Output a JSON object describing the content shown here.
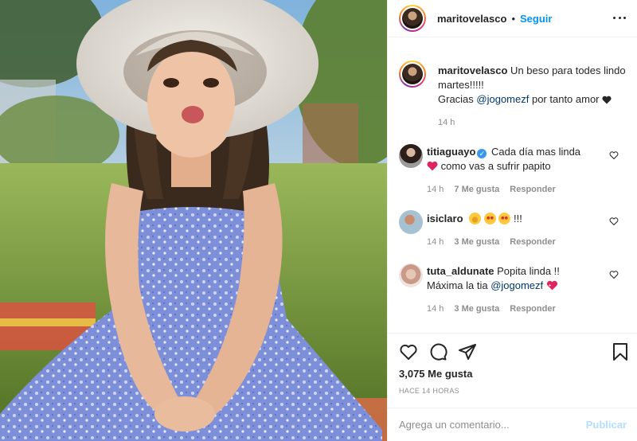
{
  "post": {
    "username": "maritovelasco",
    "separator": "•",
    "follow_label": "Seguir",
    "more_label": "more-options-icon"
  },
  "caption": {
    "username": "maritovelasco",
    "text_1": " Un beso para todes lindo martes!!!!!",
    "text_2": "Gracias ",
    "mention": "@jogomezf",
    "text_3": " por tanto amor",
    "time": "14 h"
  },
  "comments": [
    {
      "username": "titiaguayo",
      "verified": true,
      "text_1": " Cada día mas linda",
      "text_2": " como vas a sufrir papito",
      "time": "14 h",
      "likes": "7 Me gusta",
      "reply": "Responder"
    },
    {
      "username": "isiclaro",
      "text_1": " !!!",
      "time": "14 h",
      "likes": "3 Me gusta",
      "reply": "Responder"
    },
    {
      "username": "tuta_aldunate",
      "text_1": " Popita linda !!",
      "text_2": "Máxima la tia ",
      "mention": "@jogomezf",
      "time": "14 h",
      "likes": "3 Me gusta",
      "reply": "Responder"
    }
  ],
  "actions": {
    "like_icon": "heart-outline-icon",
    "comment_icon": "comment-bubble-icon",
    "share_icon": "paper-plane-icon",
    "save_icon": "bookmark-icon",
    "likes_count": "3,075 Me gusta",
    "time_ago": "HACE 14 HORAS"
  },
  "composer": {
    "placeholder": "Agrega un comentario...",
    "publish_label": "Publicar"
  },
  "colors": {
    "accent": "#0095f6",
    "mention": "#00376b",
    "muted": "#8e8e8e",
    "publish_disabled": "#b2dffc"
  }
}
